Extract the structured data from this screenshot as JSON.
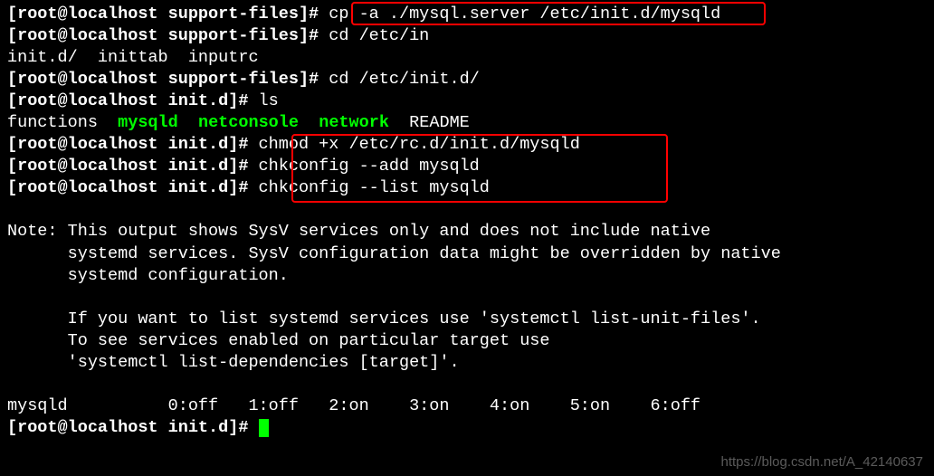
{
  "prompts": {
    "p1_prefix": "[root@localhost support-files]# ",
    "p1_cmd": "cp -a ./mysql.server /etc/init.d/mysqld",
    "p2_prefix": "[root@localhost support-files]# ",
    "p2_cmd": "cd /etc/in",
    "tab_complete": "init.d/  inittab  inputrc",
    "p3_prefix": "[root@localhost support-files]# ",
    "p3_cmd": "cd /etc/init.d/",
    "p4_prefix": "[root@localhost init.d]# ",
    "p4_cmd": "ls",
    "ls_functions": "functions  ",
    "ls_mysqld": "mysqld",
    "ls_netconsole": "netconsole",
    "ls_network": "network",
    "ls_readme": "README",
    "p5_prefix": "[root@localhost init.d]# ",
    "p5_cmd": "chmod +x /etc/rc.d/init.d/mysqld",
    "p6_prefix": "[root@localhost init.d]# ",
    "p6_cmd": "chkconfig --add mysqld",
    "p7_prefix": "[root@localhost init.d]# ",
    "p7_cmd": "chkconfig --list mysqld",
    "note_l1": "Note: This output shows SysV services only and does not include native",
    "note_l2": "      systemd services. SysV configuration data might be overridden by native",
    "note_l3": "      systemd configuration.",
    "note_l4": "      If you want to list systemd services use 'systemctl list-unit-files'.",
    "note_l5": "      To see services enabled on particular target use",
    "note_l6": "      'systemctl list-dependencies [target]'.",
    "status": "mysqld          0:off   1:off   2:on    3:on    4:on    5:on    6:off",
    "p8_prefix": "[root@localhost init.d]# "
  },
  "watermark": "https://blog.csdn.net/A_42140637"
}
